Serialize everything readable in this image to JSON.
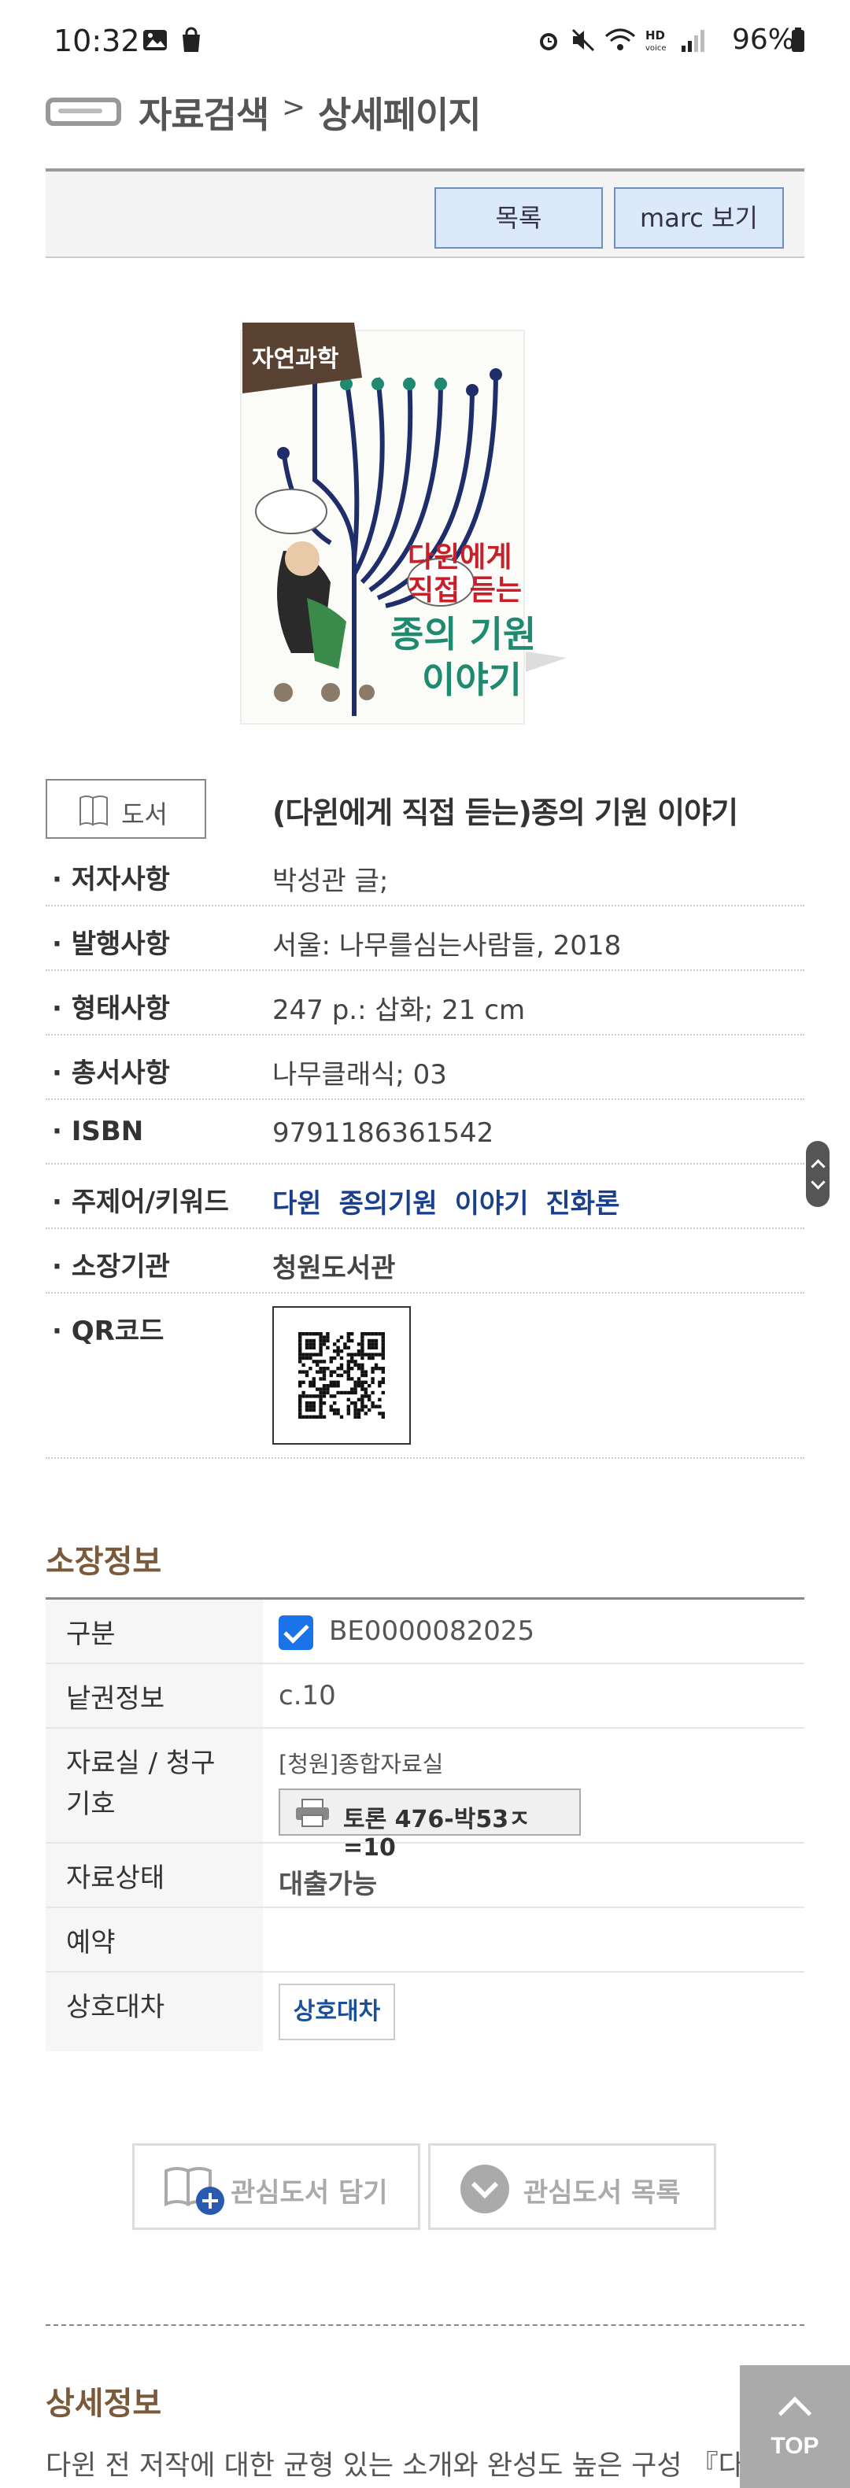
{
  "status_bar": {
    "time": "10:32",
    "battery": "96%"
  },
  "header": {
    "title": "자료검색",
    "separator": ">",
    "subtitle": "상세페이지"
  },
  "toolbar": {
    "list_label": "목록",
    "marc_label": "marc 보기"
  },
  "cover": {
    "badge": "자연과학",
    "line1": "다윈에게",
    "line2": "직접 듣는",
    "line3": "종의 기원",
    "line4": "이야기"
  },
  "book": {
    "type": "도서",
    "title": "(다윈에게 직접 듣는)종의 기원 이야기",
    "rows": [
      {
        "label": "· 저자사항",
        "value": "박성관 글;"
      },
      {
        "label": "· 발행사항",
        "value": "서울: 나무를심는사람들, 2018"
      },
      {
        "label": "· 형태사항",
        "value": "247 p.: 삽화; 21 cm"
      },
      {
        "label": "· 총서사항",
        "value": "나무클래식; 03"
      },
      {
        "label": "· ISBN",
        "value": "9791186361542"
      }
    ],
    "keyword_label": "· 주제어/키워드",
    "keywords": [
      "다윈",
      "종의기원",
      "이야기",
      "진화론"
    ],
    "library_label": "· 소장기관",
    "library": "청원도서관",
    "qr_label": "· QR코드"
  },
  "holding": {
    "title": "소장정보",
    "rows": [
      {
        "label": "구분",
        "value": "BE0000082025"
      },
      {
        "label": "낱권정보",
        "value": "c.10"
      },
      {
        "label": "자료실 / 청구기호",
        "label_line1": "자료실 / 청구",
        "label_line2": "기호",
        "room": "[청원]종합자료실",
        "call_number": "토론 476-박53ㅈ=10"
      },
      {
        "label": "자료상태",
        "value": "대출가능"
      },
      {
        "label": "예약",
        "value": ""
      },
      {
        "label": "상호대차",
        "button": "상호대차"
      }
    ]
  },
  "actions": {
    "add_favorite": "관심도서 담기",
    "favorite_list": "관심도서 목록"
  },
  "details": {
    "title": "상세정보",
    "text": "다윈 전 저작에 대한 균형 있는 소개와 완성도 높은 구성 『다윈에"
  },
  "top_button": "TOP"
}
